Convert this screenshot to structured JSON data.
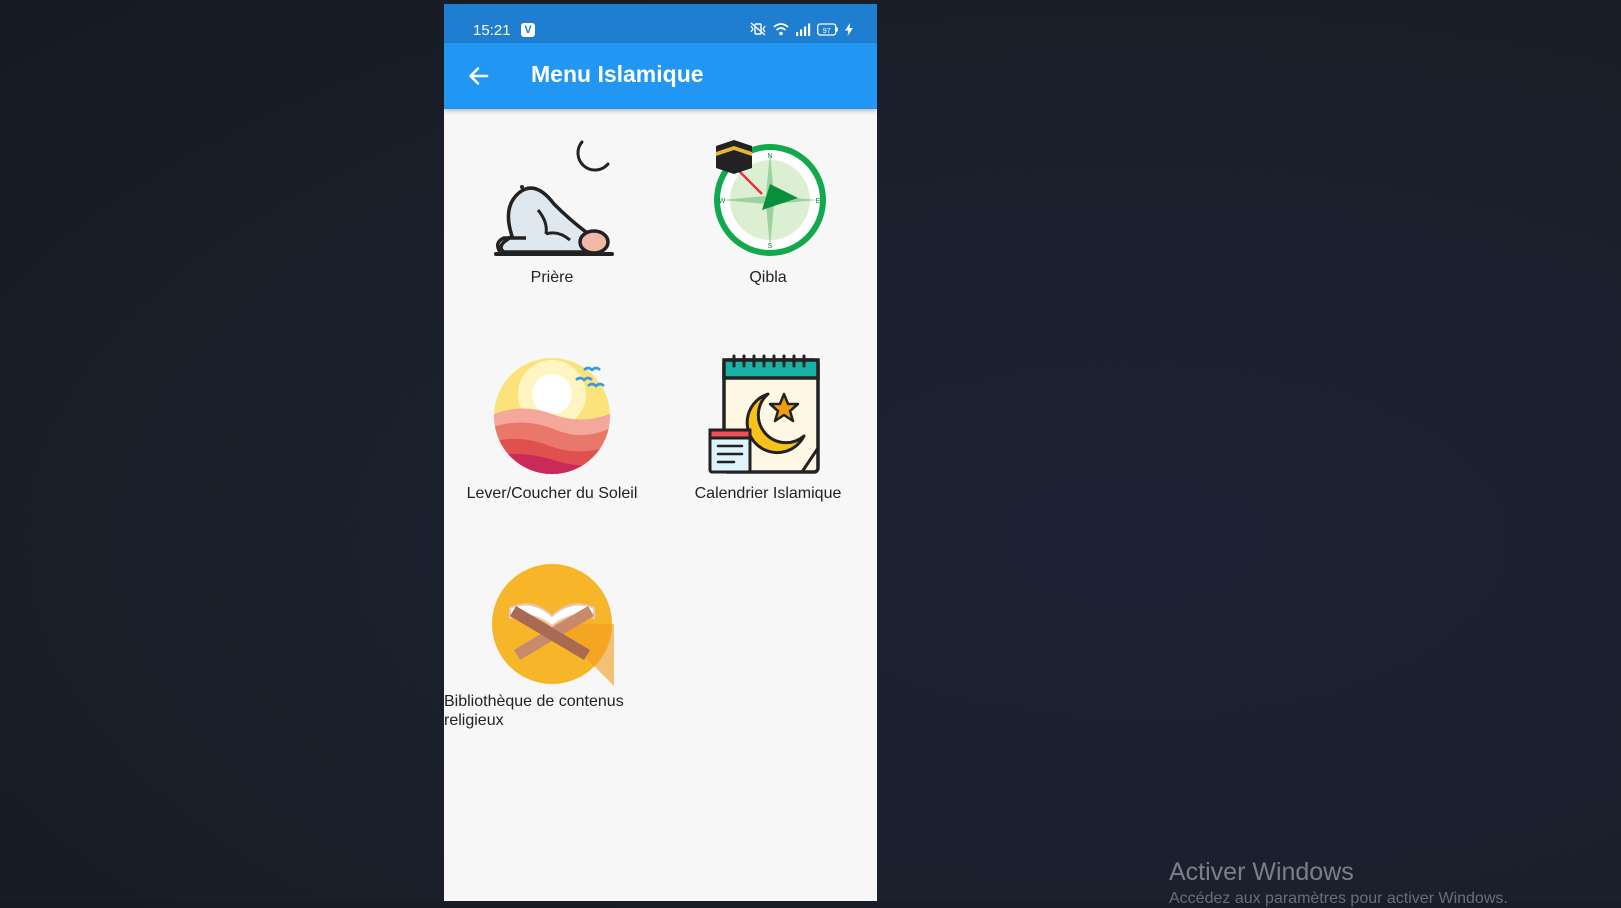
{
  "status_bar": {
    "time": "15:21",
    "badge": "V",
    "battery": "97"
  },
  "app_bar": {
    "title": "Menu Islamique"
  },
  "menu_items": [
    {
      "label": "Prière",
      "icon": "praying-person-moon-icon"
    },
    {
      "label": "Qibla",
      "icon": "kaaba-compass-icon"
    },
    {
      "label": "Lever/Coucher du Soleil",
      "icon": "sunset-icon"
    },
    {
      "label": "Calendrier Islamique",
      "icon": "islamic-calendar-icon"
    },
    {
      "label": "Bibliothèque de contenus religieux",
      "icon": "quran-book-icon"
    }
  ],
  "watermark": {
    "title": "Activer Windows",
    "subtitle": "Accédez aux paramètres pour activer Windows."
  }
}
